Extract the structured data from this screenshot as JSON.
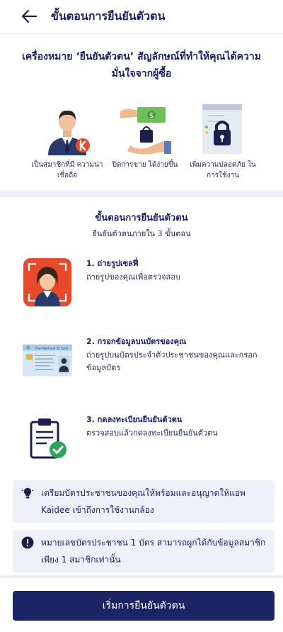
{
  "header": {
    "title": "ขั้นตอนการยืนยันตัวตน",
    "back_icon": "arrow-left-icon"
  },
  "badge": {
    "title": "เครื่องหมาย ‘ยืนยันตัวตน’ สัญลักษณ์ที่ทำให้คุณได้ความมั่นใจจากผู้ซื้อ",
    "benefits": [
      {
        "icon": "trusted-member-icon",
        "label": "เป็นสมาชิกที่มี ความน่าเชื่อถือ"
      },
      {
        "icon": "money-exchange-icon",
        "label": "ปิดการขาย ได้ง่ายขึ้น"
      },
      {
        "icon": "padlock-icon",
        "label": "เพิ่มความปลอดภัย ในการใช้งาน"
      }
    ]
  },
  "steps_section": {
    "title": "ขั้นตอนการยืนยันตัวตน",
    "subtitle": "ยืนยันตัวตนภายใน 3 ขั้นตอน",
    "steps": [
      {
        "icon": "selfie-icon",
        "title": "1. ถ่ายรูปเซลฟี่",
        "desc": "ถ่ายรูปของคุณเพื่อตรวจสอบ"
      },
      {
        "icon": "id-card-icon",
        "title": "2. กรอกข้อมูลบนบัตรของคุณ",
        "desc": "ถ่ายรูปบนบัตรประจำตัวประชาชนของคุณและกรอกข้อมูลบัตร",
        "card_heading": "Thai National ID Card"
      },
      {
        "icon": "clipboard-check-icon",
        "title": "3. กดลงทะเบียนยืนยันตัวตน",
        "desc": "ตรวจสอบแล้วกดลงทะเบียนยืนยันตัวตน"
      }
    ]
  },
  "notes": [
    {
      "icon": "lightbulb-icon",
      "text": "เตรียมบัตรประชาชนของคุณให้พร้อมและอนุญาตให้แอพ Kaidee เข้าถึงการใช้งานกล้อง"
    },
    {
      "icon": "exclamation-icon",
      "text": "หมายเลขบัตรประชาชน 1 บัตร สามารถผูกได้กับข้อมูลสมาชิกเพียง 1 สมาชิกเท่านั้น"
    }
  ],
  "cta": {
    "label": "เริ่มการยืนยันตัวตน"
  },
  "colors": {
    "primary": "#1c2466",
    "accent": "#e7492b",
    "success": "#2fa35a"
  }
}
